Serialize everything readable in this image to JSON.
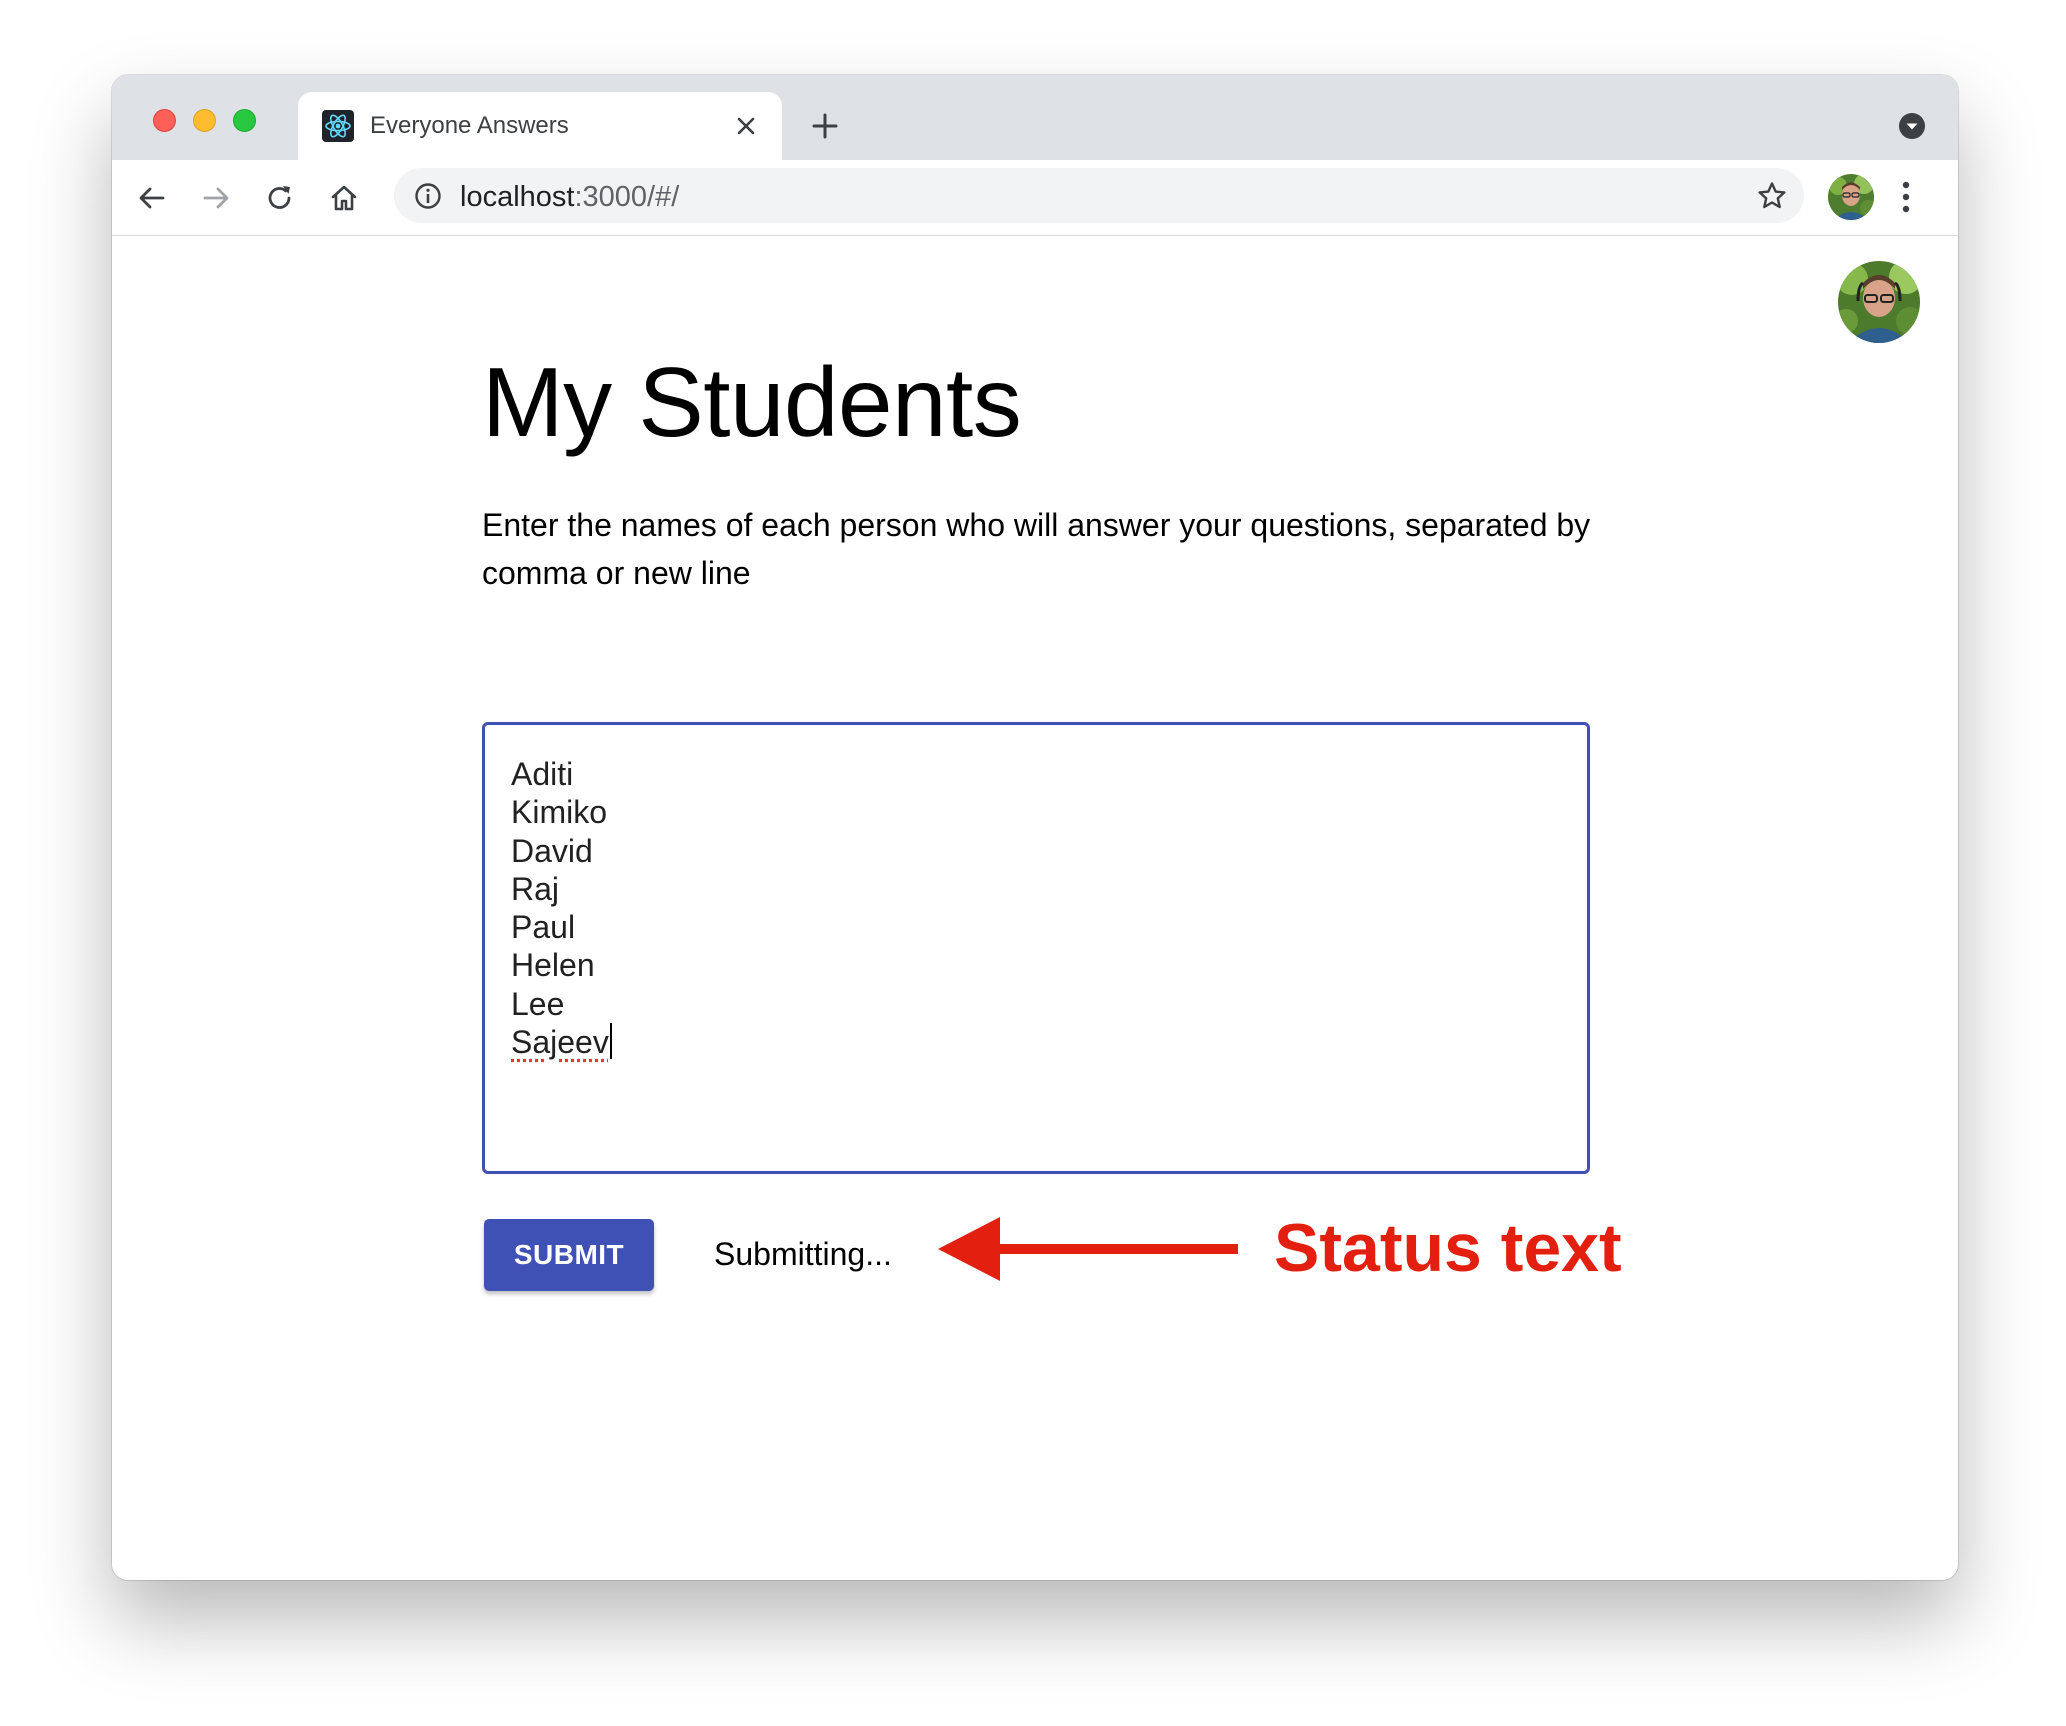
{
  "browser": {
    "tab_title": "Everyone Answers",
    "url_host": "localhost",
    "url_path": ":3000/#/"
  },
  "page": {
    "title": "My Students",
    "instructions": "Enter the names of each person who will answer your questions, separated by comma or new line",
    "names": [
      "Aditi",
      "Kimiko",
      "David",
      "Raj",
      "Paul",
      "Helen",
      "Lee",
      "Sajeev"
    ],
    "submit_label": "SUBMIT",
    "status_text": "Submitting..."
  },
  "annotation": {
    "label": "Status text",
    "color": "#e3200f"
  },
  "colors": {
    "primary": "#3f51b5",
    "tabbar": "#dee1e6",
    "omnibox": "#f1f3f4"
  },
  "icons": [
    "react-favicon-icon",
    "close-icon",
    "plus-icon",
    "tab-search-icon",
    "back-arrow-icon",
    "forward-arrow-icon",
    "reload-icon",
    "home-icon",
    "info-icon",
    "star-icon",
    "kebab-menu-icon",
    "avatar"
  ]
}
